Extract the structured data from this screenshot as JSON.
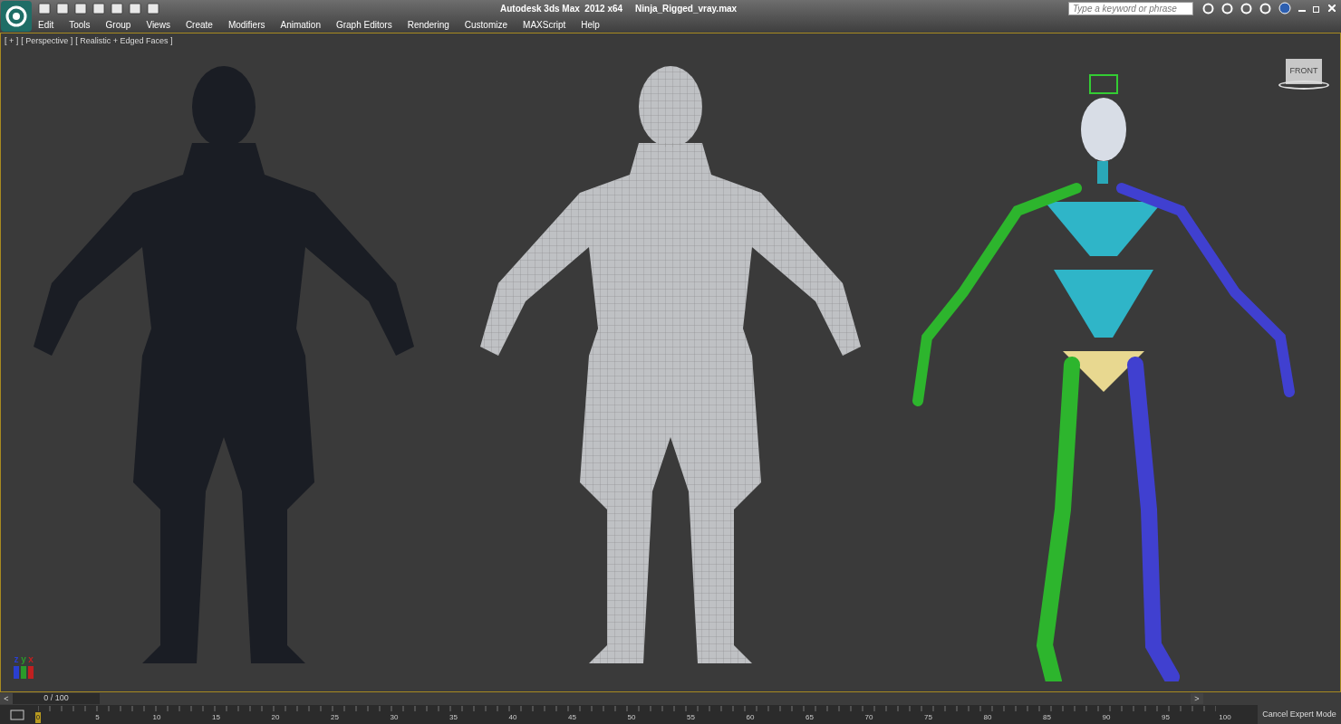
{
  "title_bar": {
    "app_title": "Autodesk 3ds Max  2012 x64",
    "file_name": "Ninja_Rigged_vray.max",
    "search": {
      "placeholder": "Type a keyword or phrase"
    }
  },
  "menu": [
    "Edit",
    "Tools",
    "Group",
    "Views",
    "Create",
    "Modifiers",
    "Animation",
    "Graph Editors",
    "Rendering",
    "Customize",
    "MAXScript",
    "Help"
  ],
  "viewport": {
    "labels": [
      "[ + ]",
      "[ Perspective ]",
      "[ Realistic + Edged Faces ]"
    ],
    "viewcube_label": "FRONT",
    "axes": [
      {
        "label": "z",
        "color": "#2a3fd0"
      },
      {
        "label": "y",
        "color": "#2a9a2a"
      },
      {
        "label": "x",
        "color": "#c02020"
      }
    ]
  },
  "time_slider": {
    "prev": "<",
    "position": "0 / 100",
    "next": ">",
    "level": 0
  },
  "track_bar": {
    "ticks": [
      "0",
      "5",
      "10",
      "15",
      "20",
      "25",
      "30",
      "35",
      "40",
      "45",
      "50",
      "55",
      "60",
      "65",
      "70",
      "75",
      "80",
      "85",
      "90",
      "95",
      "100"
    ]
  },
  "expert_mode_button": "Cancel Expert Mode"
}
